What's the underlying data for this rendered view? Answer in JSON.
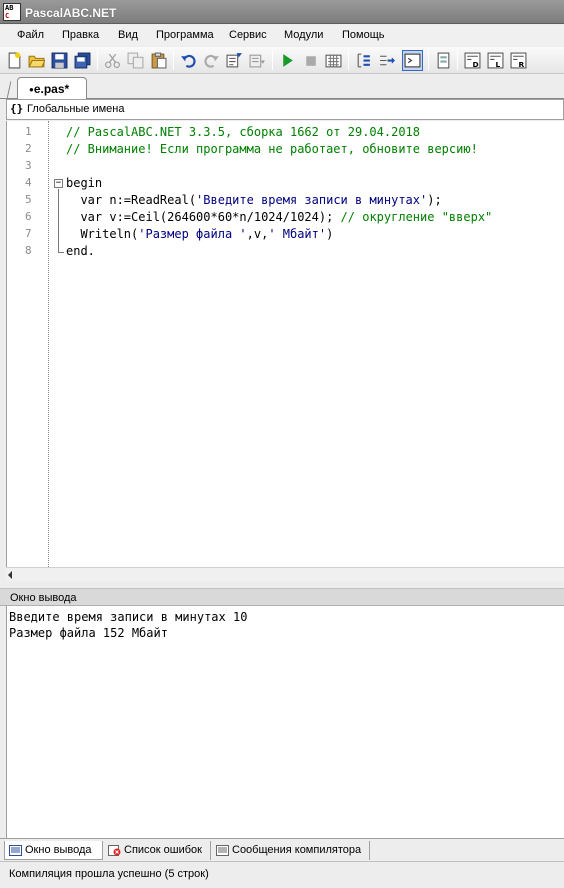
{
  "window": {
    "title": "PascalABC.NET",
    "icon_letters": [
      "AB",
      "C"
    ]
  },
  "menu": {
    "items": [
      "Файл",
      "Правка",
      "Вид",
      "Программа",
      "Сервис",
      "Модули",
      "Помощь"
    ]
  },
  "toolbar": {
    "buttons": [
      "new-file-icon",
      "open-icon",
      "save-icon",
      "save-all-icon",
      "cut-icon",
      "copy-icon",
      "paste-icon",
      "undo-icon",
      "redo-icon",
      "find-icon",
      "replace-icon",
      "run-icon",
      "stop-icon",
      "compile-icon",
      "debug-step-icon",
      "debug-into-icon",
      "output-window-icon",
      "form-icon",
      "exe-d-icon",
      "exe-l-icon",
      "exe-r-icon"
    ]
  },
  "tabs": [
    {
      "label": "e.pas*",
      "modified_marker": "●"
    }
  ],
  "scope": {
    "icon": "{}",
    "label": "Глобальные имена"
  },
  "editor": {
    "line_numbers": [
      "1",
      "2",
      "3",
      "4",
      "5",
      "6",
      "7",
      "8"
    ],
    "lines": [
      [
        {
          "t": "// PascalABC.NET 3.3.5, сборка 1662 от 29.04.2018",
          "k": "comment"
        }
      ],
      [
        {
          "t": "// Внимание! Если программа не работает, обновите версию!",
          "k": "comment"
        }
      ],
      [],
      [
        {
          "t": "begin",
          "k": "kw"
        }
      ],
      [
        {
          "t": "  var n:=ReadReal(",
          "k": "plain"
        },
        {
          "t": "'Введите время записи в минутах'",
          "k": "str"
        },
        {
          "t": ");",
          "k": "plain"
        }
      ],
      [
        {
          "t": "  var v:=Ceil(264600*60*n/1024/1024); ",
          "k": "plain"
        },
        {
          "t": "// округление \"вверх\"",
          "k": "comment"
        }
      ],
      [
        {
          "t": "  Writeln(",
          "k": "plain"
        },
        {
          "t": "'Размер файла '",
          "k": "str"
        },
        {
          "t": ",v,",
          "k": "plain"
        },
        {
          "t": "' Мбайт'",
          "k": "str"
        },
        {
          "t": ")",
          "k": "plain"
        }
      ],
      [
        {
          "t": "end.",
          "k": "kw"
        }
      ]
    ]
  },
  "output": {
    "title": "Окно вывода",
    "lines": [
      "Введите время записи в минутах 10",
      "Размер файла 152 Мбайт"
    ]
  },
  "bottom_tabs": [
    {
      "label": "Окно вывода",
      "icon": "output-window-icon",
      "active": true
    },
    {
      "label": "Список ошибок",
      "icon": "error-list-icon",
      "active": false
    },
    {
      "label": "Сообщения компилятора",
      "icon": "compiler-messages-icon",
      "active": false
    }
  ],
  "status": {
    "text": "Компиляция прошла успешно (5 строк)"
  },
  "colors": {
    "comment": "#008000",
    "string": "#000080",
    "keyword": "#000000",
    "line_number": "#8c8c8c",
    "titlebar": "#8a8a8a"
  }
}
